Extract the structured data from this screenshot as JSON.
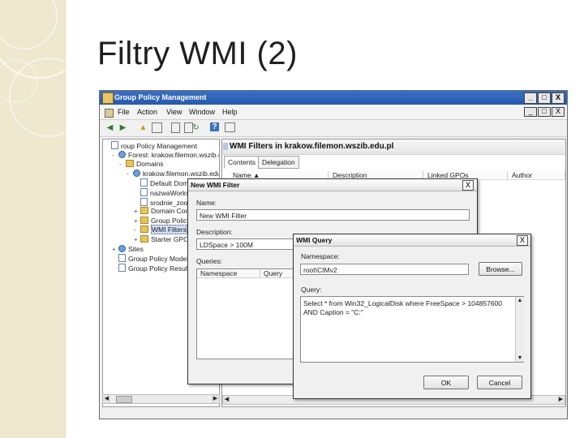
{
  "slide": {
    "title": "Filtry WMI (2)"
  },
  "window": {
    "title": "Group Policy Management",
    "controls": [
      "_",
      "□",
      "X"
    ],
    "inner_controls": [
      "_",
      "□",
      "X"
    ]
  },
  "menu": [
    "File",
    "Action",
    "View",
    "Window",
    "Help"
  ],
  "toolbar_icons": [
    "back-icon",
    "forward-icon",
    "up-folder-icon",
    "console-tree-icon",
    "properties-icon",
    "export-icon",
    "refresh-icon",
    "help-icon",
    "view-icon"
  ],
  "tree": {
    "items": [
      {
        "label": "roup Policy Management",
        "indent": 0,
        "icon": "doc",
        "exp": ""
      },
      {
        "label": "Forest: krakow.filemon.wszib.edu.pl",
        "indent": 1,
        "icon": "glb",
        "exp": "-"
      },
      {
        "label": "Domains",
        "indent": 2,
        "icon": "fol",
        "exp": "-"
      },
      {
        "label": "krakow.filemon.wszib.edu.pl",
        "indent": 3,
        "icon": "glb",
        "exp": "-"
      },
      {
        "label": "Default Domain Policy",
        "indent": 4,
        "icon": "doc",
        "exp": ""
      },
      {
        "label": "nazwaWorkstations",
        "indent": 4,
        "icon": "doc",
        "exp": ""
      },
      {
        "label": "srodnie_zoowe",
        "indent": 4,
        "icon": "doc",
        "exp": ""
      },
      {
        "label": "Domain Controllers",
        "indent": 4,
        "icon": "fol",
        "exp": "+"
      },
      {
        "label": "Group Policy Objects",
        "indent": 4,
        "icon": "fol",
        "exp": "+"
      },
      {
        "label": "WMI Filters",
        "indent": 4,
        "icon": "fol",
        "exp": "-",
        "selected": true
      },
      {
        "label": "Starter GPOs",
        "indent": 4,
        "icon": "fol",
        "exp": "+"
      },
      {
        "label": "Sites",
        "indent": 1,
        "icon": "glb",
        "exp": "+"
      },
      {
        "label": "Group Policy Modeling",
        "indent": 1,
        "icon": "doc",
        "exp": ""
      },
      {
        "label": "Group Policy Results",
        "indent": 1,
        "icon": "doc",
        "exp": ""
      }
    ]
  },
  "right_pane": {
    "title": "WMI Filters in krakow.filemon.wszib.edu.pl",
    "tabs": [
      "Contents",
      "Delegation"
    ],
    "columns": [
      "Name ▲",
      "Description",
      "Linked GPOs",
      "Author"
    ]
  },
  "new_wmi_dialog": {
    "title": "New WMI Filter",
    "close": "X",
    "name_label": "Name:",
    "name_value": "New WMI Filter",
    "description_label": "Description:",
    "description_value": "LDSpace > 100M",
    "queries_label": "Queries:",
    "queries_columns": [
      "Namespace",
      "Query"
    ]
  },
  "wmi_query_dialog": {
    "title": "WMI Query",
    "close": "X",
    "namespace_label": "Namespace:",
    "namespace_value": "root\\CIMv2",
    "browse_button": "Browse...",
    "query_label": "Query:",
    "query_value": "Select * from Win32_LogicalDisk where FreeSpace > 104857600 AND Caption = \"C:\"",
    "ok_button": "OK",
    "cancel_button": "Cancel"
  }
}
